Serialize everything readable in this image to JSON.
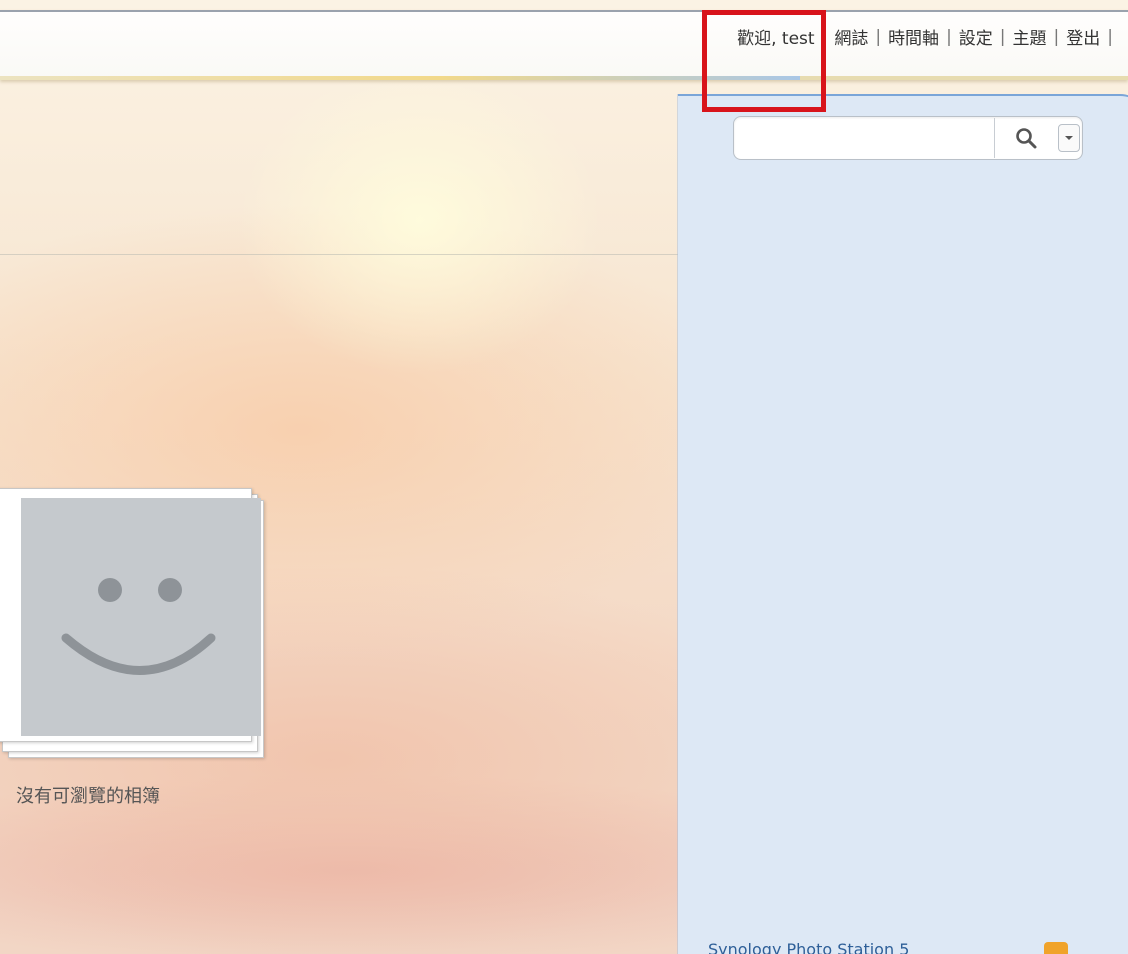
{
  "topnav": {
    "welcome": "歡迎, test",
    "items": [
      "網誌",
      "時間軸",
      "設定",
      "主題",
      "登出"
    ]
  },
  "search": {
    "value": "",
    "placeholder": ""
  },
  "album": {
    "empty_caption": "沒有可瀏覽的相簿"
  },
  "sidebar": {
    "footer_link": "Synology Photo Station 5"
  },
  "icons": {
    "search": "search-icon",
    "dropdown": "chevron-down-icon",
    "smiley": "smiley-placeholder-icon",
    "rss": "rss-icon"
  },
  "colors": {
    "highlight": "#d8141b",
    "sidebar_bg": "#dde8f5",
    "placeholder_gray": "#c5c9cd"
  }
}
